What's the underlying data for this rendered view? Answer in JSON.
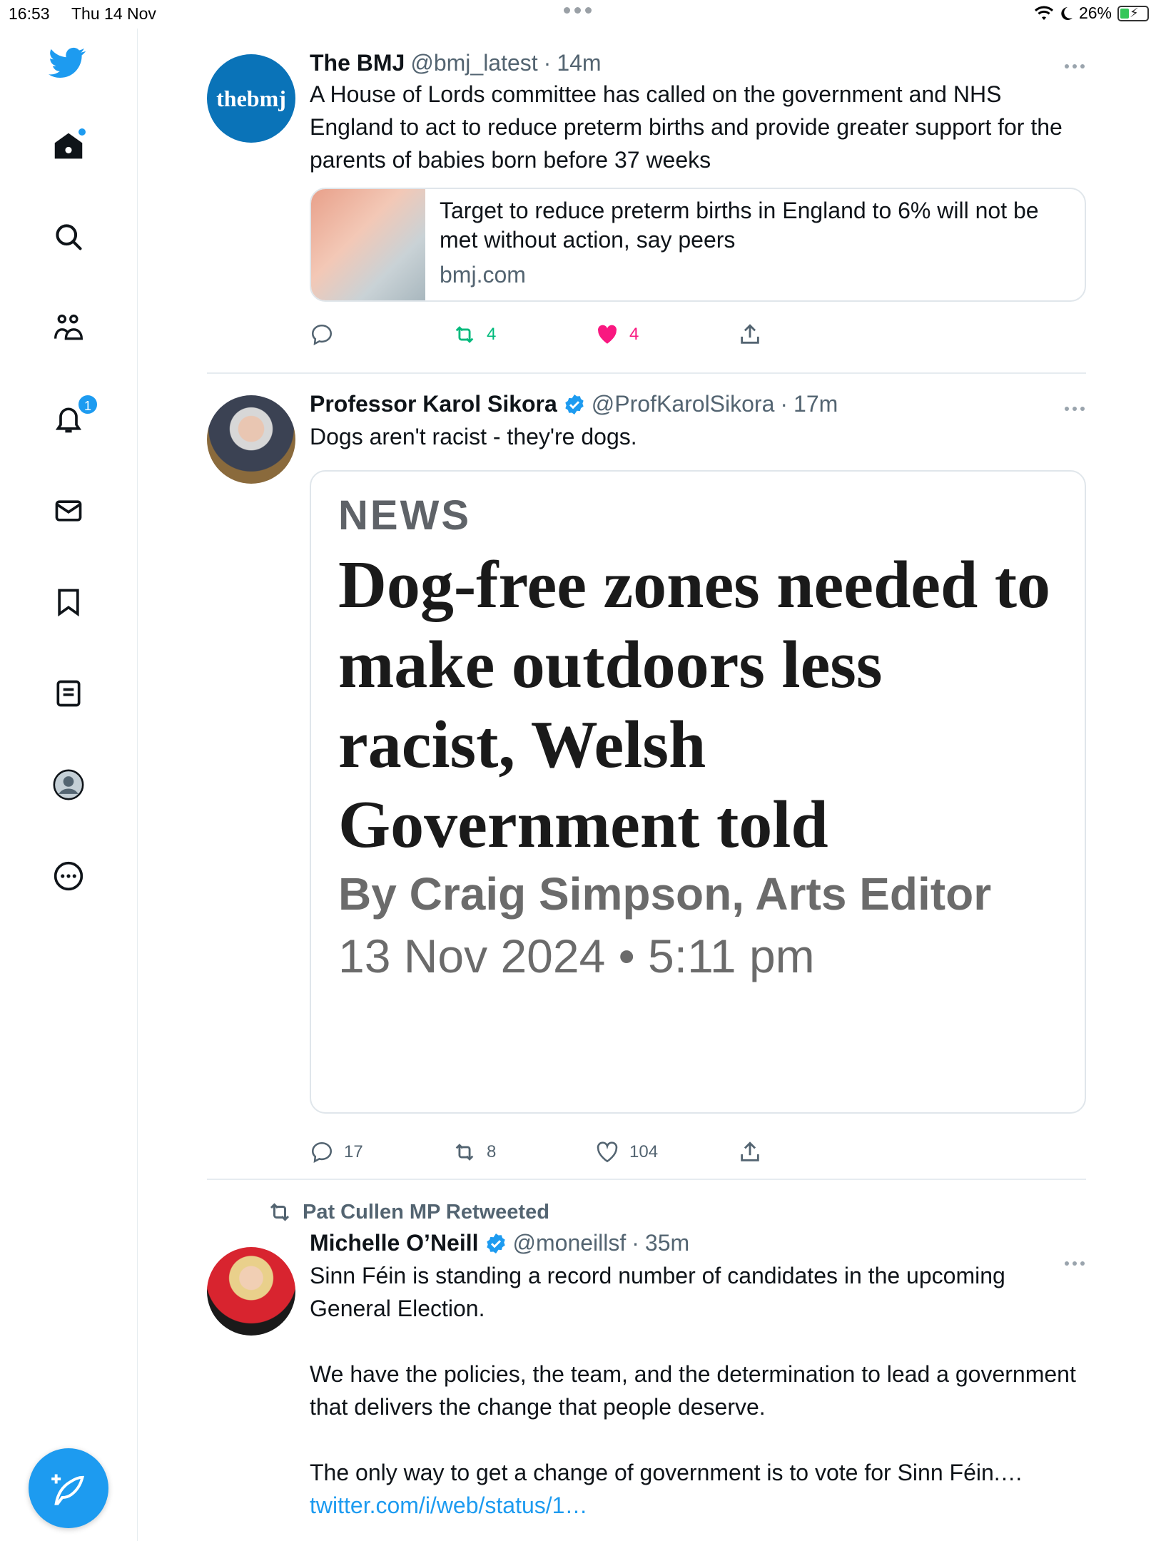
{
  "status_bar": {
    "time": "16:53",
    "date": "Thu 14 Nov",
    "battery": "26%"
  },
  "sidebar": {
    "notifications_count": "1"
  },
  "tweets": [
    {
      "name": "The BMJ",
      "handle": "@bmj_latest",
      "sep": "·",
      "time": "14m",
      "avatar_text": "thebmj",
      "text": "A House of Lords committee has called on the government and NHS England to act to reduce preterm births and provide greater support for the parents of babies born before 37 weeks",
      "card": {
        "title": "Target to reduce preterm births in England to 6% will not be met without action, say peers",
        "domain": "bmj.com"
      },
      "retweets": "4",
      "likes": "4"
    },
    {
      "name": "Professor Karol Sikora",
      "handle": "@ProfKarolSikora",
      "sep": "·",
      "time": "17m",
      "text": "Dogs aren't racist - they're dogs.",
      "image": {
        "label": "NEWS",
        "headline": "Dog-free zones needed to make outdoors less racist, Welsh Government told",
        "byline": "By Craig Simpson, Arts Editor",
        "date": "13 Nov 2024 • 5:11 pm"
      },
      "replies": "17",
      "retweets": "8",
      "likes": "104"
    },
    {
      "retweeted_by": "Pat Cullen MP Retweeted",
      "name": "Michelle O’Neill",
      "handle": "@moneillsf",
      "sep": "·",
      "time": "35m",
      "text_p1": "Sinn Féin is standing a record number of candidates in the upcoming General Election.",
      "text_p2": "We have the policies, the team, and the determination to lead a government that delivers the change that people deserve.",
      "text_p3": "The only way to get a change of government is to vote for Sinn Féin.…",
      "link": "twitter.com/i/web/status/1…"
    }
  ],
  "colors": {
    "accent": "#1d9bf0",
    "retweet_active": "#00ba7c",
    "like_active": "#f91880"
  }
}
